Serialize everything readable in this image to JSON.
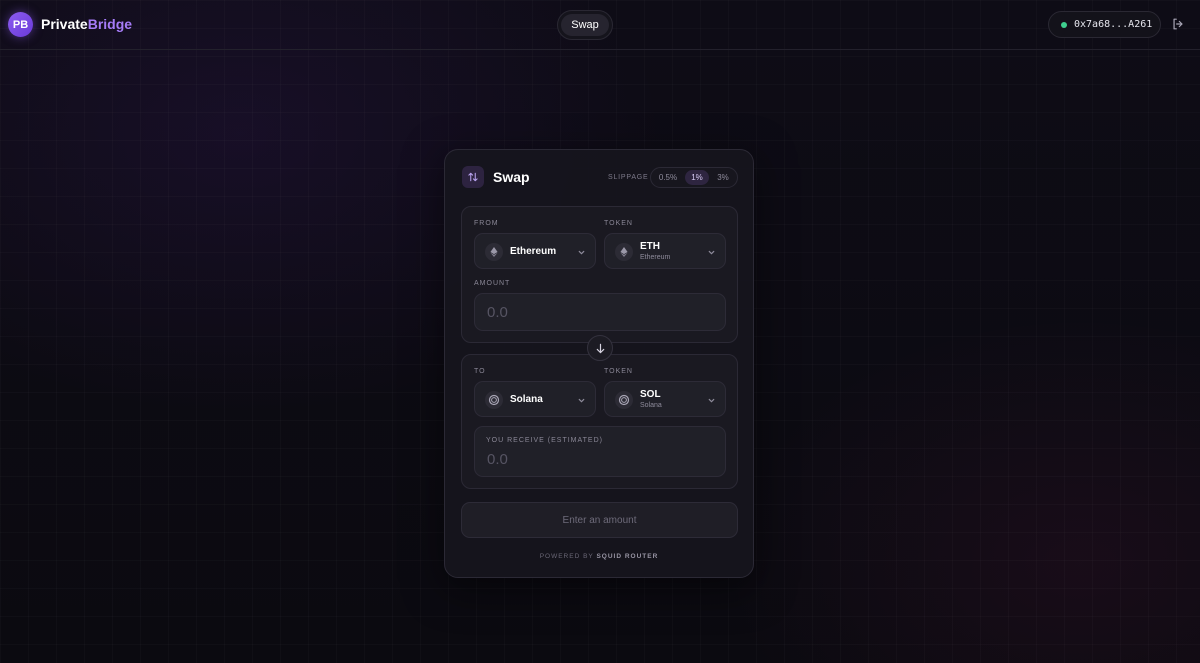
{
  "brand": {
    "badge": "PB",
    "name_part1": "Private",
    "name_part2": "Bridge"
  },
  "nav": {
    "swap_label": "Swap"
  },
  "wallet": {
    "address": "0x7a68...A261",
    "status_color": "#3ecf8e"
  },
  "colors": {
    "accent": "#a67cf8",
    "connected": "#3ecf8e"
  },
  "card": {
    "title": "Swap",
    "slippage_label": "SLIPPAGE",
    "slippage_options": [
      "0.5%",
      "1%",
      "3%"
    ],
    "slippage_selected": "1%"
  },
  "from": {
    "label": "FROM",
    "chain": "Ethereum",
    "chain_icon": "ethereum-icon",
    "token_label": "TOKEN",
    "token_symbol": "ETH",
    "token_name": "Ethereum",
    "amount_label": "AMOUNT",
    "amount_placeholder": "0.0"
  },
  "to": {
    "label": "TO",
    "chain": "Solana",
    "chain_icon": "solana-icon",
    "token_label": "TOKEN",
    "token_symbol": "SOL",
    "token_name": "Solana",
    "receive_label": "YOU RECEIVE (ESTIMATED)",
    "receive_value": "0.0"
  },
  "action": {
    "label": "Enter an amount"
  },
  "footer": {
    "prefix": "POWERED BY",
    "provider": "SQUID ROUTER"
  }
}
